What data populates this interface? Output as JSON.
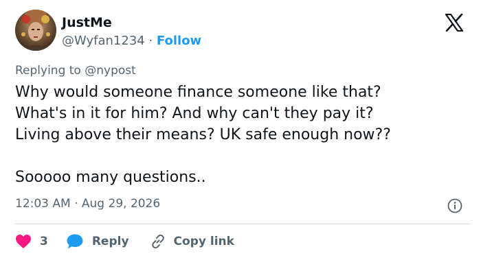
{
  "user": {
    "display_name": "JustMe",
    "handle": "@Wyfan1234",
    "separator": "·",
    "follow_label": "Follow"
  },
  "tweet": {
    "replying_to": "Replying to @nypost",
    "text": "Why would someone finance someone like that?\nWhat's in it for him? And why can't they pay it?\nLiving above their means? UK safe enough now??\n\nSooooo many questions..",
    "timestamp": "12:03 AM · Aug 29, 2026"
  },
  "actions": {
    "like_count": "3",
    "reply_label": "Reply",
    "copy_link_label": "Copy link"
  },
  "icons": {
    "logo": "x-logo-icon",
    "info": "info-icon",
    "like": "heart-icon",
    "reply": "speech-bubble-icon",
    "copy": "link-icon"
  },
  "colors": {
    "accent": "#1d9bf0",
    "like": "#f91880",
    "text": "#0f1419",
    "muted": "#536471"
  }
}
